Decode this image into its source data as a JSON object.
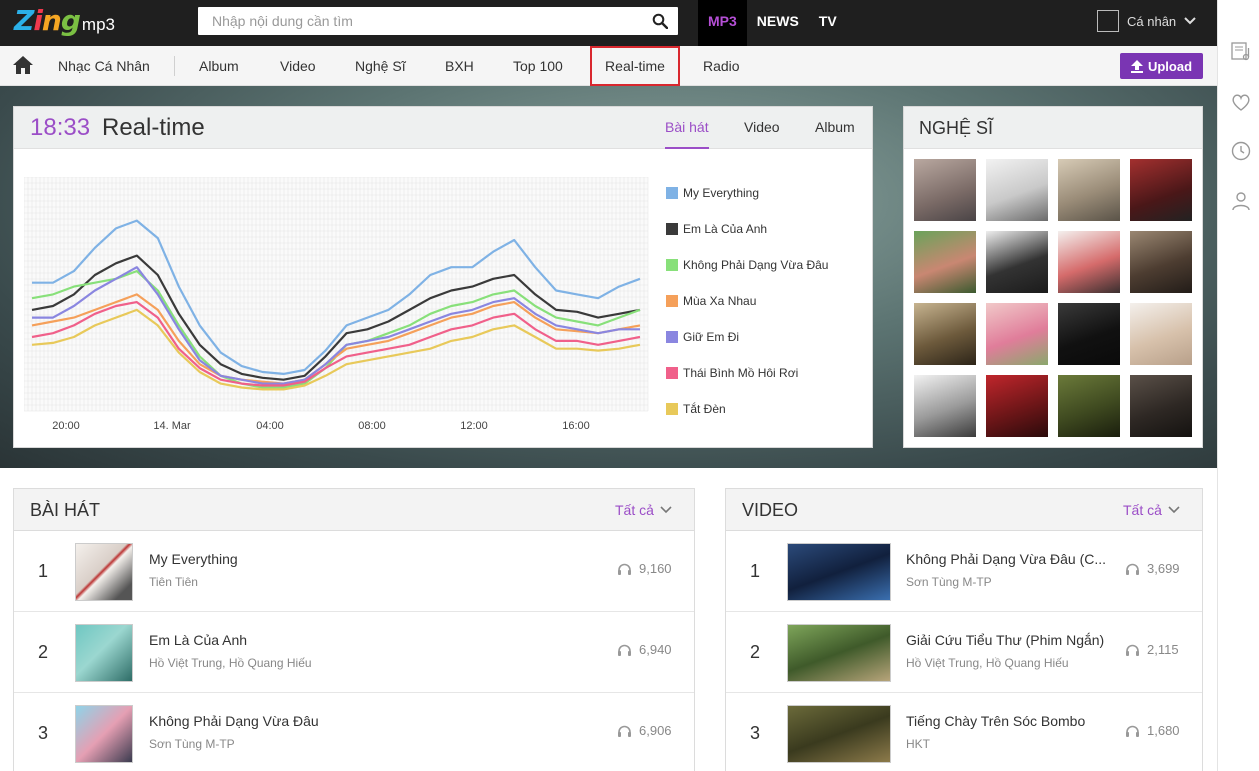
{
  "header": {
    "logo_text": "Zing",
    "logo_sub": "mp3",
    "search_placeholder": "Nhập nội dung cần tìm",
    "topnav": [
      "MP3",
      "NEWS",
      "TV"
    ],
    "user_label": "Cá nhân"
  },
  "subnav": {
    "items": [
      "Nhạc Cá Nhân",
      "Album",
      "Video",
      "Nghệ Sĩ",
      "BXH",
      "Top 100",
      "Real-time",
      "Radio"
    ],
    "upload_label": "Upload"
  },
  "realtime": {
    "time": "18:33",
    "title": "Real-time",
    "tabs": [
      "Bài hát",
      "Video",
      "Album"
    ],
    "active_tab": "Bài hát"
  },
  "artists": {
    "title": "NGHỆ SĨ"
  },
  "songs_panel": {
    "title": "BÀI HÁT",
    "see_all": "Tất cả",
    "rows": [
      {
        "rank": "1",
        "title": "My Everything",
        "artist": "Tiên Tiên",
        "listens": "9,160"
      },
      {
        "rank": "2",
        "title": "Em Là Của Anh",
        "artist": "Hồ Việt Trung,  Hồ Quang Hiếu",
        "listens": "6,940"
      },
      {
        "rank": "3",
        "title": "Không Phải Dạng Vừa Đâu",
        "artist": "Sơn Tùng M-TP",
        "listens": "6,906"
      }
    ]
  },
  "videos_panel": {
    "title": "VIDEO",
    "see_all": "Tất cả",
    "rows": [
      {
        "rank": "1",
        "title": "Không Phải Dạng Vừa Đâu (C...",
        "artist": "Sơn Tùng M-TP",
        "listens": "3,699"
      },
      {
        "rank": "2",
        "title": "Giải Cứu Tiểu Thư (Phim Ngắn)",
        "artist": "Hồ Việt Trung,  Hồ Quang Hiếu",
        "listens": "2,115"
      },
      {
        "rank": "3",
        "title": "Tiếng Chày Trên Sóc Bombo",
        "artist": "HKT",
        "listens": "1,680"
      }
    ]
  },
  "colors": {
    "accent": "#9b4ec7",
    "upload_bg": "#7a35b3",
    "highlight_border": "#d9272e"
  },
  "chart_data": {
    "type": "line",
    "x_ticks": [
      "20:00",
      "14. Mar",
      "04:00",
      "08:00",
      "12:00",
      "16:00"
    ],
    "grid": true,
    "legend_position": "right",
    "series": [
      {
        "name": "My Everything",
        "color": "#7fb2e5",
        "values": [
          62,
          62,
          68,
          80,
          90,
          94,
          85,
          60,
          40,
          26,
          19,
          16,
          15,
          17,
          27,
          40,
          44,
          48,
          56,
          66,
          70,
          70,
          78,
          84,
          70,
          58,
          56,
          54,
          60,
          64
        ]
      },
      {
        "name": "Em Là Của Anh",
        "color": "#3a3a3a",
        "values": [
          48,
          50,
          56,
          66,
          72,
          76,
          66,
          46,
          30,
          20,
          15,
          13,
          12,
          14,
          24,
          36,
          38,
          42,
          48,
          54,
          58,
          60,
          64,
          66,
          56,
          48,
          47,
          44,
          46,
          48
        ]
      },
      {
        "name": "Không Phải Dạng Vừa Đâu",
        "color": "#88e07a",
        "values": [
          54,
          56,
          60,
          62,
          64,
          68,
          58,
          40,
          24,
          14,
          10,
          8,
          8,
          10,
          18,
          30,
          32,
          36,
          40,
          46,
          50,
          52,
          56,
          58,
          50,
          44,
          42,
          40,
          44,
          48
        ]
      },
      {
        "name": "Mùa Xa Nhau",
        "color": "#f5a05a",
        "values": [
          40,
          42,
          44,
          48,
          52,
          56,
          48,
          32,
          20,
          14,
          12,
          11,
          10,
          12,
          20,
          28,
          30,
          32,
          36,
          40,
          44,
          46,
          50,
          52,
          44,
          38,
          37,
          36,
          38,
          40
        ]
      },
      {
        "name": "Giữ Em Đi",
        "color": "#8a86e0",
        "values": [
          44,
          44,
          50,
          58,
          64,
          70,
          56,
          38,
          22,
          14,
          12,
          10,
          10,
          12,
          20,
          30,
          32,
          34,
          38,
          42,
          46,
          48,
          52,
          54,
          46,
          40,
          38,
          36,
          38,
          38
        ]
      },
      {
        "name": "Thái Bình Mồ Hôi Rơi",
        "color": "#f0608a",
        "values": [
          34,
          36,
          40,
          46,
          50,
          52,
          44,
          28,
          18,
          12,
          10,
          9,
          9,
          11,
          18,
          24,
          26,
          28,
          30,
          34,
          38,
          40,
          44,
          46,
          38,
          32,
          32,
          30,
          32,
          34
        ]
      },
      {
        "name": "Tắt Đèn",
        "color": "#e8c95a",
        "values": [
          30,
          31,
          34,
          40,
          44,
          48,
          40,
          26,
          16,
          10,
          8,
          7,
          7,
          9,
          14,
          20,
          22,
          24,
          26,
          28,
          32,
          34,
          38,
          40,
          34,
          28,
          28,
          27,
          28,
          30
        ]
      }
    ],
    "ylim": [
      0,
      100
    ]
  }
}
